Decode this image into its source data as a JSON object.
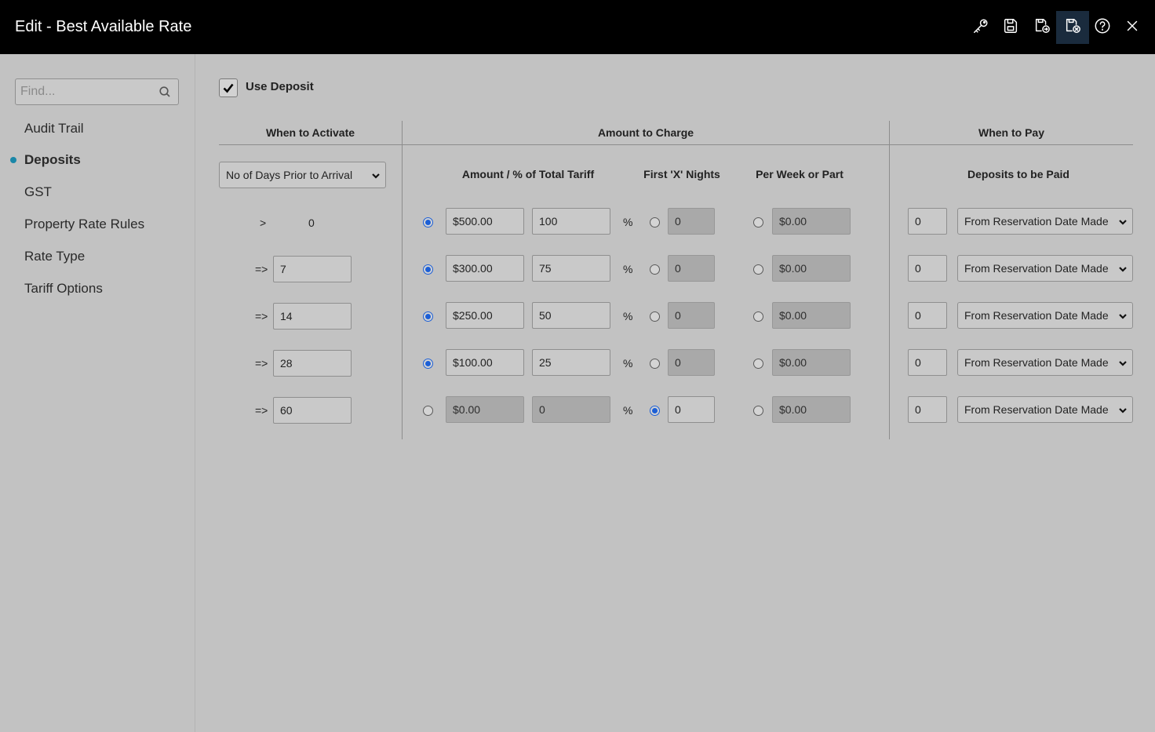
{
  "window": {
    "title": "Edit - Best Available Rate"
  },
  "toolbar": {
    "icons": [
      "key-icon",
      "save-icon",
      "save-exit-icon",
      "save-close-icon",
      "help-icon",
      "close-icon"
    ]
  },
  "sidebar": {
    "search_placeholder": "Find...",
    "items": [
      {
        "label": "Audit Trail",
        "active": false
      },
      {
        "label": "Deposits",
        "active": true
      },
      {
        "label": "GST",
        "active": false
      },
      {
        "label": "Property Rate Rules",
        "active": false
      },
      {
        "label": "Rate Type",
        "active": false
      },
      {
        "label": "Tariff Options",
        "active": false
      }
    ]
  },
  "deposit": {
    "use_deposit_label": "Use Deposit",
    "use_deposit_checked": true,
    "headers": {
      "when_to_activate": "When to Activate",
      "amount_to_charge": "Amount to Charge",
      "when_to_pay": "When to Pay",
      "amount_pct": "Amount / % of Total Tariff",
      "first_x_nights": "First 'X' Nights",
      "per_week": "Per Week or Part",
      "deposits_to_be_paid": "Deposits to be Paid"
    },
    "activate_select": "No of Days Prior to Arrival",
    "percent_symbol": "%",
    "rows": [
      {
        "op": ">",
        "days": "0",
        "amount": "$500.00",
        "percent": "100",
        "nights": "0",
        "per_week": "$0.00",
        "pay_count": "0",
        "pay_from": "From Reservation Date Made",
        "mode": "amount"
      },
      {
        "op": "=>",
        "days": "7",
        "amount": "$300.00",
        "percent": "75",
        "nights": "0",
        "per_week": "$0.00",
        "pay_count": "0",
        "pay_from": "From Reservation Date Made",
        "mode": "amount"
      },
      {
        "op": "=>",
        "days": "14",
        "amount": "$250.00",
        "percent": "50",
        "nights": "0",
        "per_week": "$0.00",
        "pay_count": "0",
        "pay_from": "From Reservation Date Made",
        "mode": "amount"
      },
      {
        "op": "=>",
        "days": "28",
        "amount": "$100.00",
        "percent": "25",
        "nights": "0",
        "per_week": "$0.00",
        "pay_count": "0",
        "pay_from": "From Reservation Date Made",
        "mode": "amount"
      },
      {
        "op": "=>",
        "days": "60",
        "amount": "$0.00",
        "percent": "0",
        "nights": "0",
        "per_week": "$0.00",
        "pay_count": "0",
        "pay_from": "From Reservation Date Made",
        "mode": "nights"
      }
    ]
  }
}
